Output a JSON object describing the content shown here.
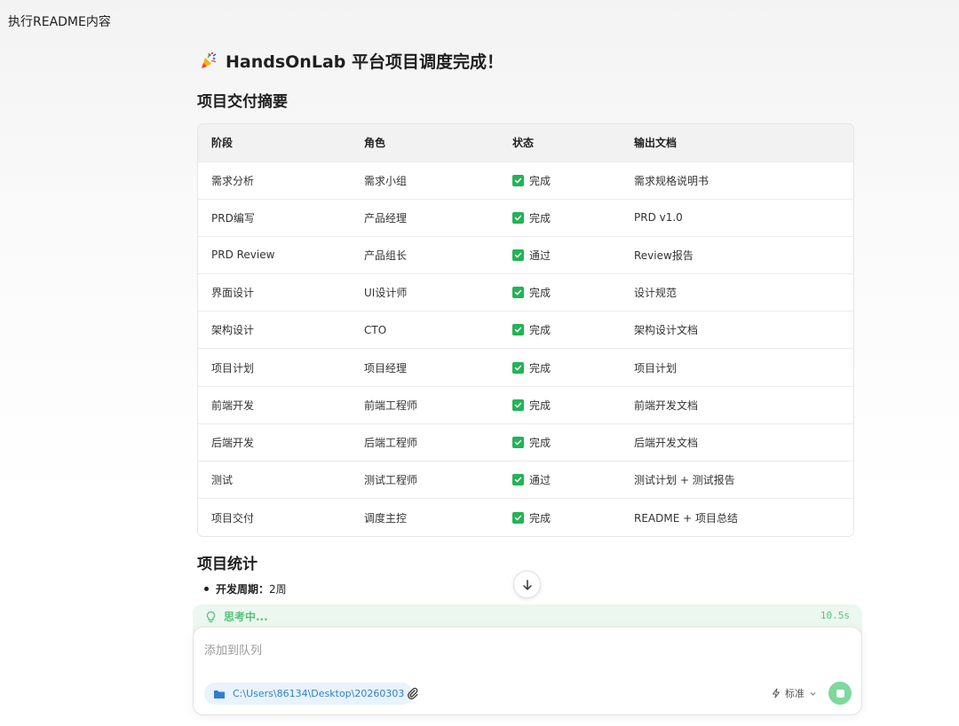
{
  "window": {
    "title": "执行README内容"
  },
  "heading": {
    "emoji": "party-popper-icon",
    "text": "HandsOnLab 平台项目调度完成！"
  },
  "summary": {
    "title": "项目交付摘要",
    "headers": [
      "阶段",
      "角色",
      "状态",
      "输出文档"
    ],
    "rows": [
      {
        "stage": "需求分析",
        "role": "需求小组",
        "status": "完成",
        "doc": "需求规格说明书"
      },
      {
        "stage": "PRD编写",
        "role": "产品经理",
        "status": "完成",
        "doc": "PRD v1.0"
      },
      {
        "stage": "PRD Review",
        "role": "产品组长",
        "status": "通过",
        "doc": "Review报告"
      },
      {
        "stage": "界面设计",
        "role": "UI设计师",
        "status": "完成",
        "doc": "设计规范"
      },
      {
        "stage": "架构设计",
        "role": "CTO",
        "status": "完成",
        "doc": "架构设计文档"
      },
      {
        "stage": "项目计划",
        "role": "项目经理",
        "status": "完成",
        "doc": "项目计划"
      },
      {
        "stage": "前端开发",
        "role": "前端工程师",
        "status": "完成",
        "doc": "前端开发文档"
      },
      {
        "stage": "后端开发",
        "role": "后端工程师",
        "status": "完成",
        "doc": "后端开发文档"
      },
      {
        "stage": "测试",
        "role": "测试工程师",
        "status": "通过",
        "doc": "测试计划 + 测试报告"
      },
      {
        "stage": "项目交付",
        "role": "调度主控",
        "status": "完成",
        "doc": "README + 项目总结"
      }
    ]
  },
  "stats": {
    "title": "项目统计",
    "items": [
      {
        "key": "开发周期：",
        "value": "2周"
      }
    ]
  },
  "thinking": {
    "label": "思考中...",
    "time": "10.5s"
  },
  "composer": {
    "placeholder": "添加到队列",
    "path": "C:\\Users\\86134\\Desktop\\20260303",
    "mode": "标准"
  },
  "colors": {
    "accent_green": "#22b455",
    "thinking_green": "#55c27a",
    "path_blue": "#2f7fd0"
  }
}
